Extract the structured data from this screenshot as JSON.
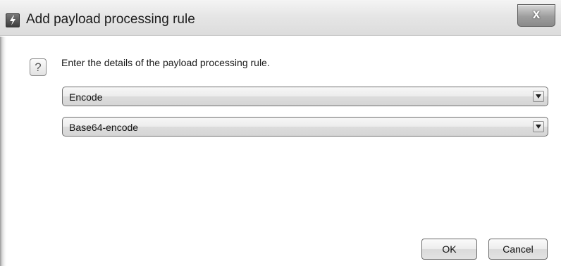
{
  "window": {
    "title": "Add payload processing rule",
    "close_glyph": "x",
    "icon": "app-bolt-icon"
  },
  "prompt": {
    "help_glyph": "?",
    "text": "Enter the details of the payload processing rule."
  },
  "fields": {
    "rule_type": {
      "value": "Encode"
    },
    "encoding": {
      "value": "Base64-encode"
    }
  },
  "buttons": {
    "ok": "OK",
    "cancel": "Cancel"
  }
}
